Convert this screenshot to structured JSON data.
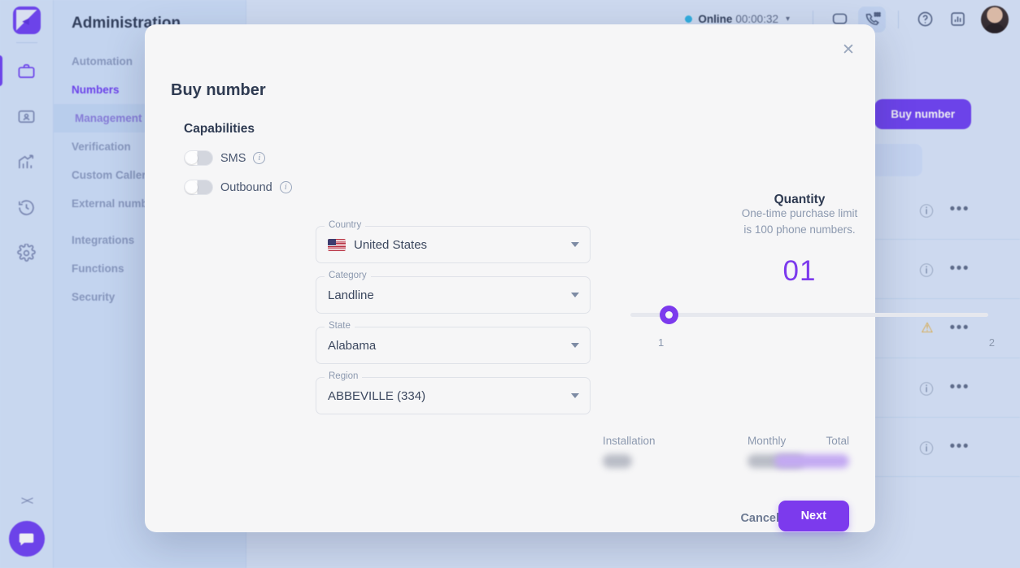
{
  "app": {
    "nav_title": "Administration",
    "rail_icons": [
      {
        "name": "app-logo",
        "glyph": "logo"
      },
      {
        "name": "briefcase-icon",
        "glyph": "briefcase",
        "active": true
      },
      {
        "name": "contact-card-icon",
        "glyph": "contact"
      },
      {
        "name": "analytics-trend-icon",
        "glyph": "trend"
      },
      {
        "name": "history-clock-icon",
        "glyph": "history"
      },
      {
        "name": "settings-gear-icon",
        "glyph": "gear"
      }
    ],
    "collapse_label": "><",
    "nav_items": [
      {
        "label": "Automation",
        "style": "plain"
      },
      {
        "label": "Numbers",
        "style": "accent"
      },
      {
        "label": "Management",
        "style": "current"
      },
      {
        "label": "Verification",
        "style": "plain"
      },
      {
        "label": "Custom Caller",
        "style": "plain"
      },
      {
        "label": "External number",
        "style": "plain"
      },
      {
        "label": "",
        "style": "gap"
      },
      {
        "label": "Integrations",
        "style": "plain"
      },
      {
        "label": "Functions",
        "style": "plain"
      },
      {
        "label": "Security",
        "style": "plain"
      }
    ]
  },
  "topbar": {
    "status_label": "Online",
    "status_time": "00:00:32",
    "caret": "▾",
    "icons": [
      {
        "name": "chat-bubble-icon"
      },
      {
        "name": "dialpad-phone-icon"
      },
      {
        "name": "help-question-icon"
      },
      {
        "name": "reports-chart-icon"
      }
    ]
  },
  "background": {
    "buy_number_button": "Buy number",
    "rows": [
      {
        "status": "none",
        "info": "info"
      },
      {
        "status": "green",
        "info": "info"
      },
      {
        "status": "green",
        "info": "warning"
      },
      {
        "status": "green",
        "info": "info"
      },
      {
        "status": "green",
        "info": "info"
      }
    ],
    "more_glyph": "•••"
  },
  "modal": {
    "title": "Buy number",
    "close_label": "✕",
    "capabilities": {
      "heading": "Capabilities",
      "toggles": [
        {
          "label": "SMS",
          "on": false,
          "info": "i"
        },
        {
          "label": "Outbound",
          "on": false,
          "info": "i"
        }
      ]
    },
    "fields": [
      {
        "legend": "Country",
        "value": "United States",
        "has_flag": true
      },
      {
        "legend": "Category",
        "value": "Landline",
        "has_flag": false
      },
      {
        "legend": "State",
        "value": "Alabama",
        "has_flag": false
      },
      {
        "legend": "Region",
        "value": "ABBEVILLE (334)",
        "has_flag": false
      }
    ],
    "quantity": {
      "heading": "Quantity",
      "subtitle_line1": "One-time purchase limit",
      "subtitle_line2": "is 100 phone numbers.",
      "value_display": "01",
      "slider_min_label": "1",
      "slider_max_label": "2",
      "slider_value": 1
    },
    "pricing": {
      "installation_label": "Installation",
      "installation_value": "",
      "monthly_label": "Monthly",
      "monthly_value": "",
      "total_label": "Total",
      "total_value": ""
    },
    "footer": {
      "cancel_label": "Cancel",
      "next_label": "Next"
    }
  },
  "colors": {
    "accent_purple": "#7c3aed",
    "brand_purple": "#6c3ef4",
    "status_online": "#2bb6e8",
    "row_green": "#57c98a",
    "warning_amber": "#e8a724",
    "modal_bg": "#f6f6f7"
  }
}
